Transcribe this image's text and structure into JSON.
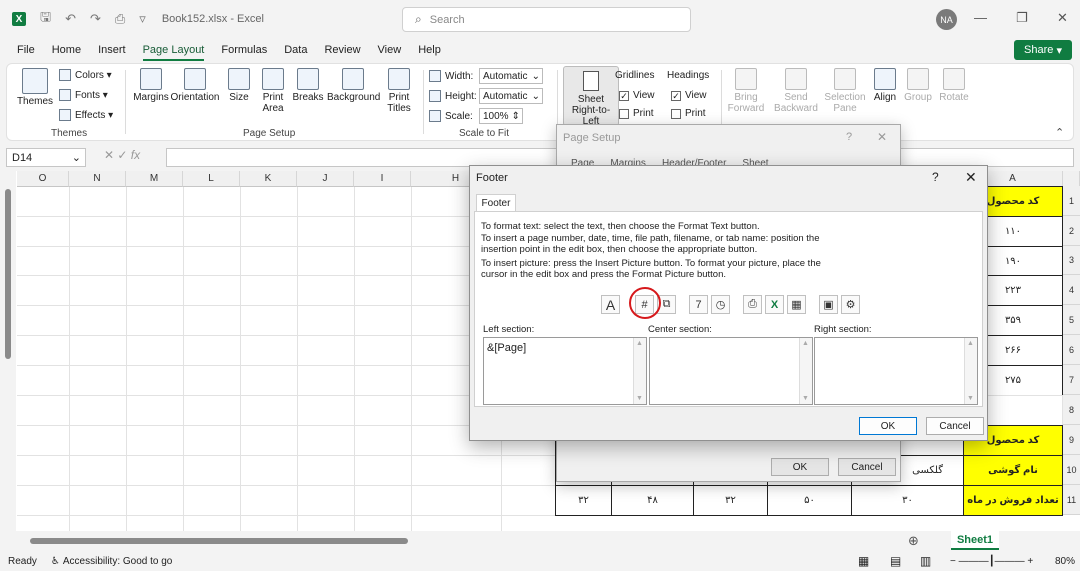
{
  "titlebar": {
    "file": "Book152.xlsx",
    "app": "Excel",
    "search_placeholder": "Search",
    "user_initials": "NA",
    "logo": "X"
  },
  "menu": [
    "File",
    "Home",
    "Insert",
    "Page Layout",
    "Formulas",
    "Data",
    "Review",
    "View",
    "Help"
  ],
  "share_label": "Share",
  "ribbon": {
    "themes": {
      "big": "Themes",
      "colors": "Colors",
      "fonts": "Fonts",
      "effects": "Effects",
      "group": "Themes"
    },
    "page_setup": {
      "margins": "Margins",
      "orientation": "Orientation",
      "size": "Size",
      "print_area": "Print Area",
      "breaks": "Breaks",
      "background": "Background",
      "print_titles": "Print Titles",
      "group": "Page Setup"
    },
    "scale": {
      "width_label": "Width:",
      "width_val": "Automatic",
      "height_label": "Height:",
      "height_val": "Automatic",
      "scale_label": "Scale:",
      "scale_val": "100%",
      "group": "Scale to Fit"
    },
    "sheet_rtl": "Sheet Right-to-Left",
    "gridlines": {
      "title": "Gridlines",
      "view": "View",
      "print": "Print"
    },
    "headings": {
      "title": "Headings",
      "view": "View",
      "print": "Print"
    },
    "arrange": {
      "bring": "Bring Forward",
      "send": "Send Backward",
      "selection": "Selection Pane",
      "align": "Align",
      "group": "Group",
      "rotate": "Rotate"
    }
  },
  "namebox": "D14",
  "columns": [
    "O",
    "N",
    "M",
    "L",
    "K",
    "J",
    "I",
    "H",
    "A"
  ],
  "rows": [
    "1",
    "2",
    "3",
    "4",
    "5",
    "6",
    "7",
    "8",
    "9",
    "10",
    "11"
  ],
  "colA": [
    "کد محصول",
    "۱۱۰",
    "۱۹۰",
    "۲۲۳",
    "۳۵۹",
    "۲۶۶",
    "۲۷۵",
    "",
    "کد محصول",
    "نام گوشی",
    "تعداد فروش در ماه"
  ],
  "row10_partial": "گلکسی",
  "row11": [
    "۳۲",
    "۴۸",
    "۳۲",
    "۵۰",
    "۳۰"
  ],
  "page_setup": {
    "title": "Page Setup",
    "help": "?",
    "close": "✕",
    "tabs": [
      "Page",
      "Margins",
      "Header/Footer",
      "Sheet"
    ],
    "ok": "OK",
    "cancel": "Cancel"
  },
  "footer": {
    "title": "Footer",
    "help": "?",
    "close": "✕",
    "tab": "Footer",
    "instructions": [
      "To format text:  select the text, then choose the Format Text button.",
      "To insert a page number, date, time, file path, filename, or tab name:  position the",
      "      insertion point in the edit box, then choose the appropriate button.",
      "To insert picture: press the Insert Picture button.  To format your picture, place the",
      "      cursor in the edit box and press the Format Picture button."
    ],
    "left_label": "Left section:",
    "center_label": "Center section:",
    "right_label": "Right section:",
    "left_value": "&[Page]",
    "center_value": "",
    "right_value": "",
    "toolbar_glyphs": {
      "format_text": "A",
      "page_number": "#",
      "pages": "⧉",
      "date": "7",
      "time": "◷",
      "file_path": "⎙",
      "file_name": "X",
      "sheet_name": "▦",
      "picture": "▣",
      "format_picture": "⚙"
    },
    "ok": "OK",
    "cancel": "Cancel"
  },
  "sheet_tab": "Sheet1",
  "status": {
    "ready": "Ready",
    "accessibility": "Accessibility: Good to go",
    "zoom": "80%"
  }
}
